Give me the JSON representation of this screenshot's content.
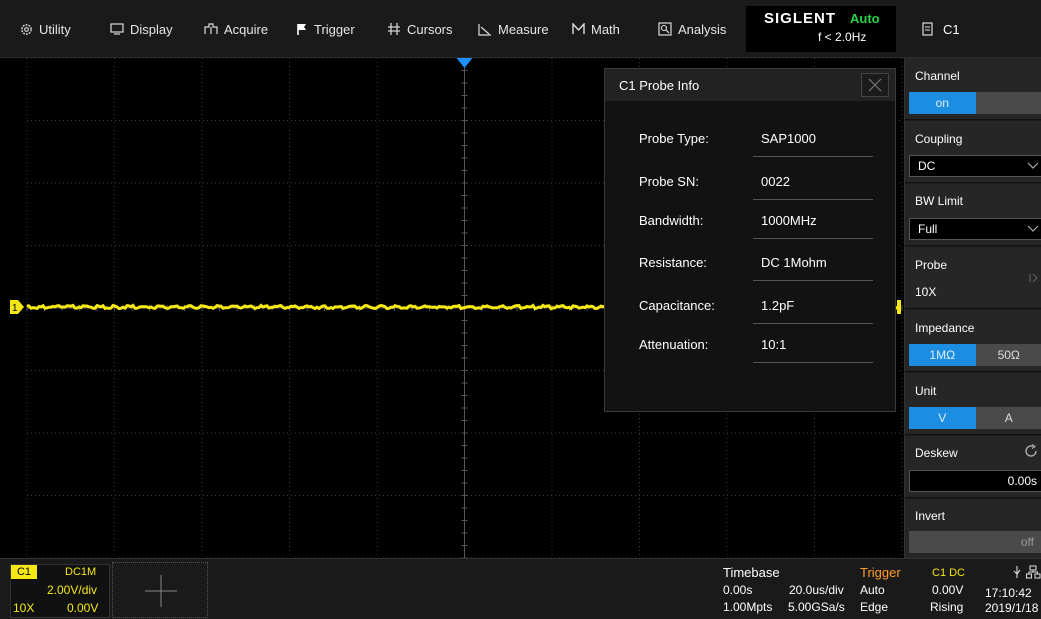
{
  "menubar": {
    "items": [
      {
        "label": "Utility",
        "icon": "gear-icon"
      },
      {
        "label": "Display",
        "icon": "monitor-icon"
      },
      {
        "label": "Acquire",
        "icon": "acquire-icon"
      },
      {
        "label": "Trigger",
        "icon": "flag-icon"
      },
      {
        "label": "Cursors",
        "icon": "cursors-icon"
      },
      {
        "label": "Measure",
        "icon": "measure-icon"
      },
      {
        "label": "Math",
        "icon": "math-icon"
      },
      {
        "label": "Analysis",
        "icon": "analysis-icon"
      }
    ],
    "brand": "SIGLENT",
    "trigger_mode": "Auto",
    "frequency": "f < 2.0Hz",
    "channel_selector": "C1"
  },
  "colors": {
    "trace": "#f5e814",
    "accent_blue": "#1c8de0",
    "trigger_marker": "#1e90ff",
    "auto_green": "#29d146",
    "trigger_orange": "#ff9c2a"
  },
  "probe_dialog": {
    "title": "C1 Probe Info",
    "rows": [
      {
        "key": "Probe Type:",
        "value": "SAP1000"
      },
      {
        "key": "Probe SN:",
        "value": "0022"
      },
      {
        "key": "Bandwidth:",
        "value": "1000MHz"
      },
      {
        "key": "Resistance:",
        "value": "DC 1Mohm"
      },
      {
        "key": "Capacitance:",
        "value": "1.2pF"
      },
      {
        "key": "Attenuation:",
        "value": "10:1"
      }
    ]
  },
  "panel": {
    "channel": {
      "label": "Channel",
      "on": "on"
    },
    "coupling": {
      "label": "Coupling",
      "value": "DC"
    },
    "bw_limit": {
      "label": "BW Limit",
      "value": "Full"
    },
    "probe": {
      "label": "Probe",
      "value": "10X"
    },
    "impedance": {
      "label": "Impedance",
      "opt1": "1MΩ",
      "opt2": "50Ω"
    },
    "unit": {
      "label": "Unit",
      "opt1": "V",
      "opt2": "A"
    },
    "deskew": {
      "label": "Deskew",
      "value": "0.00s"
    },
    "invert": {
      "label": "Invert",
      "value": "off"
    }
  },
  "bottom": {
    "c1": {
      "tag": "C1",
      "coupling": "DC1M",
      "scale": "2.00V/div",
      "probe": "10X",
      "offset": "0.00V"
    },
    "timebase": {
      "label": "Timebase",
      "delay": "0.00s",
      "scale": "20.0us/div",
      "points": "1.00Mpts",
      "rate": "5.00GSa/s"
    },
    "trigger": {
      "label": "Trigger",
      "mode": "Auto",
      "type": "Edge",
      "source": "C1 DC",
      "level": "0.00V",
      "slope": "Rising"
    },
    "clock": {
      "time": "17:10:42",
      "date": "2019/1/18"
    }
  }
}
